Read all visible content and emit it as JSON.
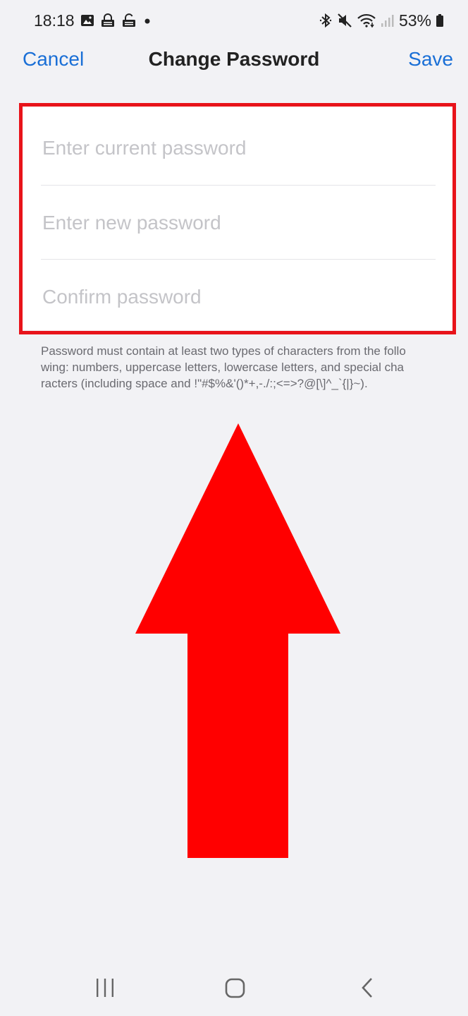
{
  "status_bar": {
    "time": "18:18",
    "battery": "53%",
    "left_icons": [
      "image-icon",
      "lock-icon",
      "unlock-icon",
      "dot-icon"
    ],
    "right_icons": [
      "bluetooth-icon",
      "mute-icon",
      "wifi-icon",
      "signal-icon",
      "battery-icon"
    ]
  },
  "nav": {
    "cancel_label": "Cancel",
    "title": "Change Password",
    "save_label": "Save"
  },
  "form": {
    "current_password": {
      "value": "",
      "placeholder": "Enter current password"
    },
    "new_password": {
      "value": "",
      "placeholder": "Enter new password"
    },
    "confirm_password": {
      "value": "",
      "placeholder": "Confirm password"
    }
  },
  "hint": "Password must contain at least two types of characters from the following: numbers, uppercase letters, lowercase letters, and special characters (including space and !\"#$%&'()*+,-./:;<=>?@[\\]^_`{|}~).",
  "annotations": {
    "highlight_color": "#e8131a",
    "arrow_color": "#ff0000"
  },
  "bottom_nav": {
    "icons": [
      "recent-apps-icon",
      "home-icon",
      "back-icon"
    ]
  },
  "colors": {
    "accent": "#1a6fd6",
    "background": "#f2f2f5",
    "card": "#ffffff"
  }
}
